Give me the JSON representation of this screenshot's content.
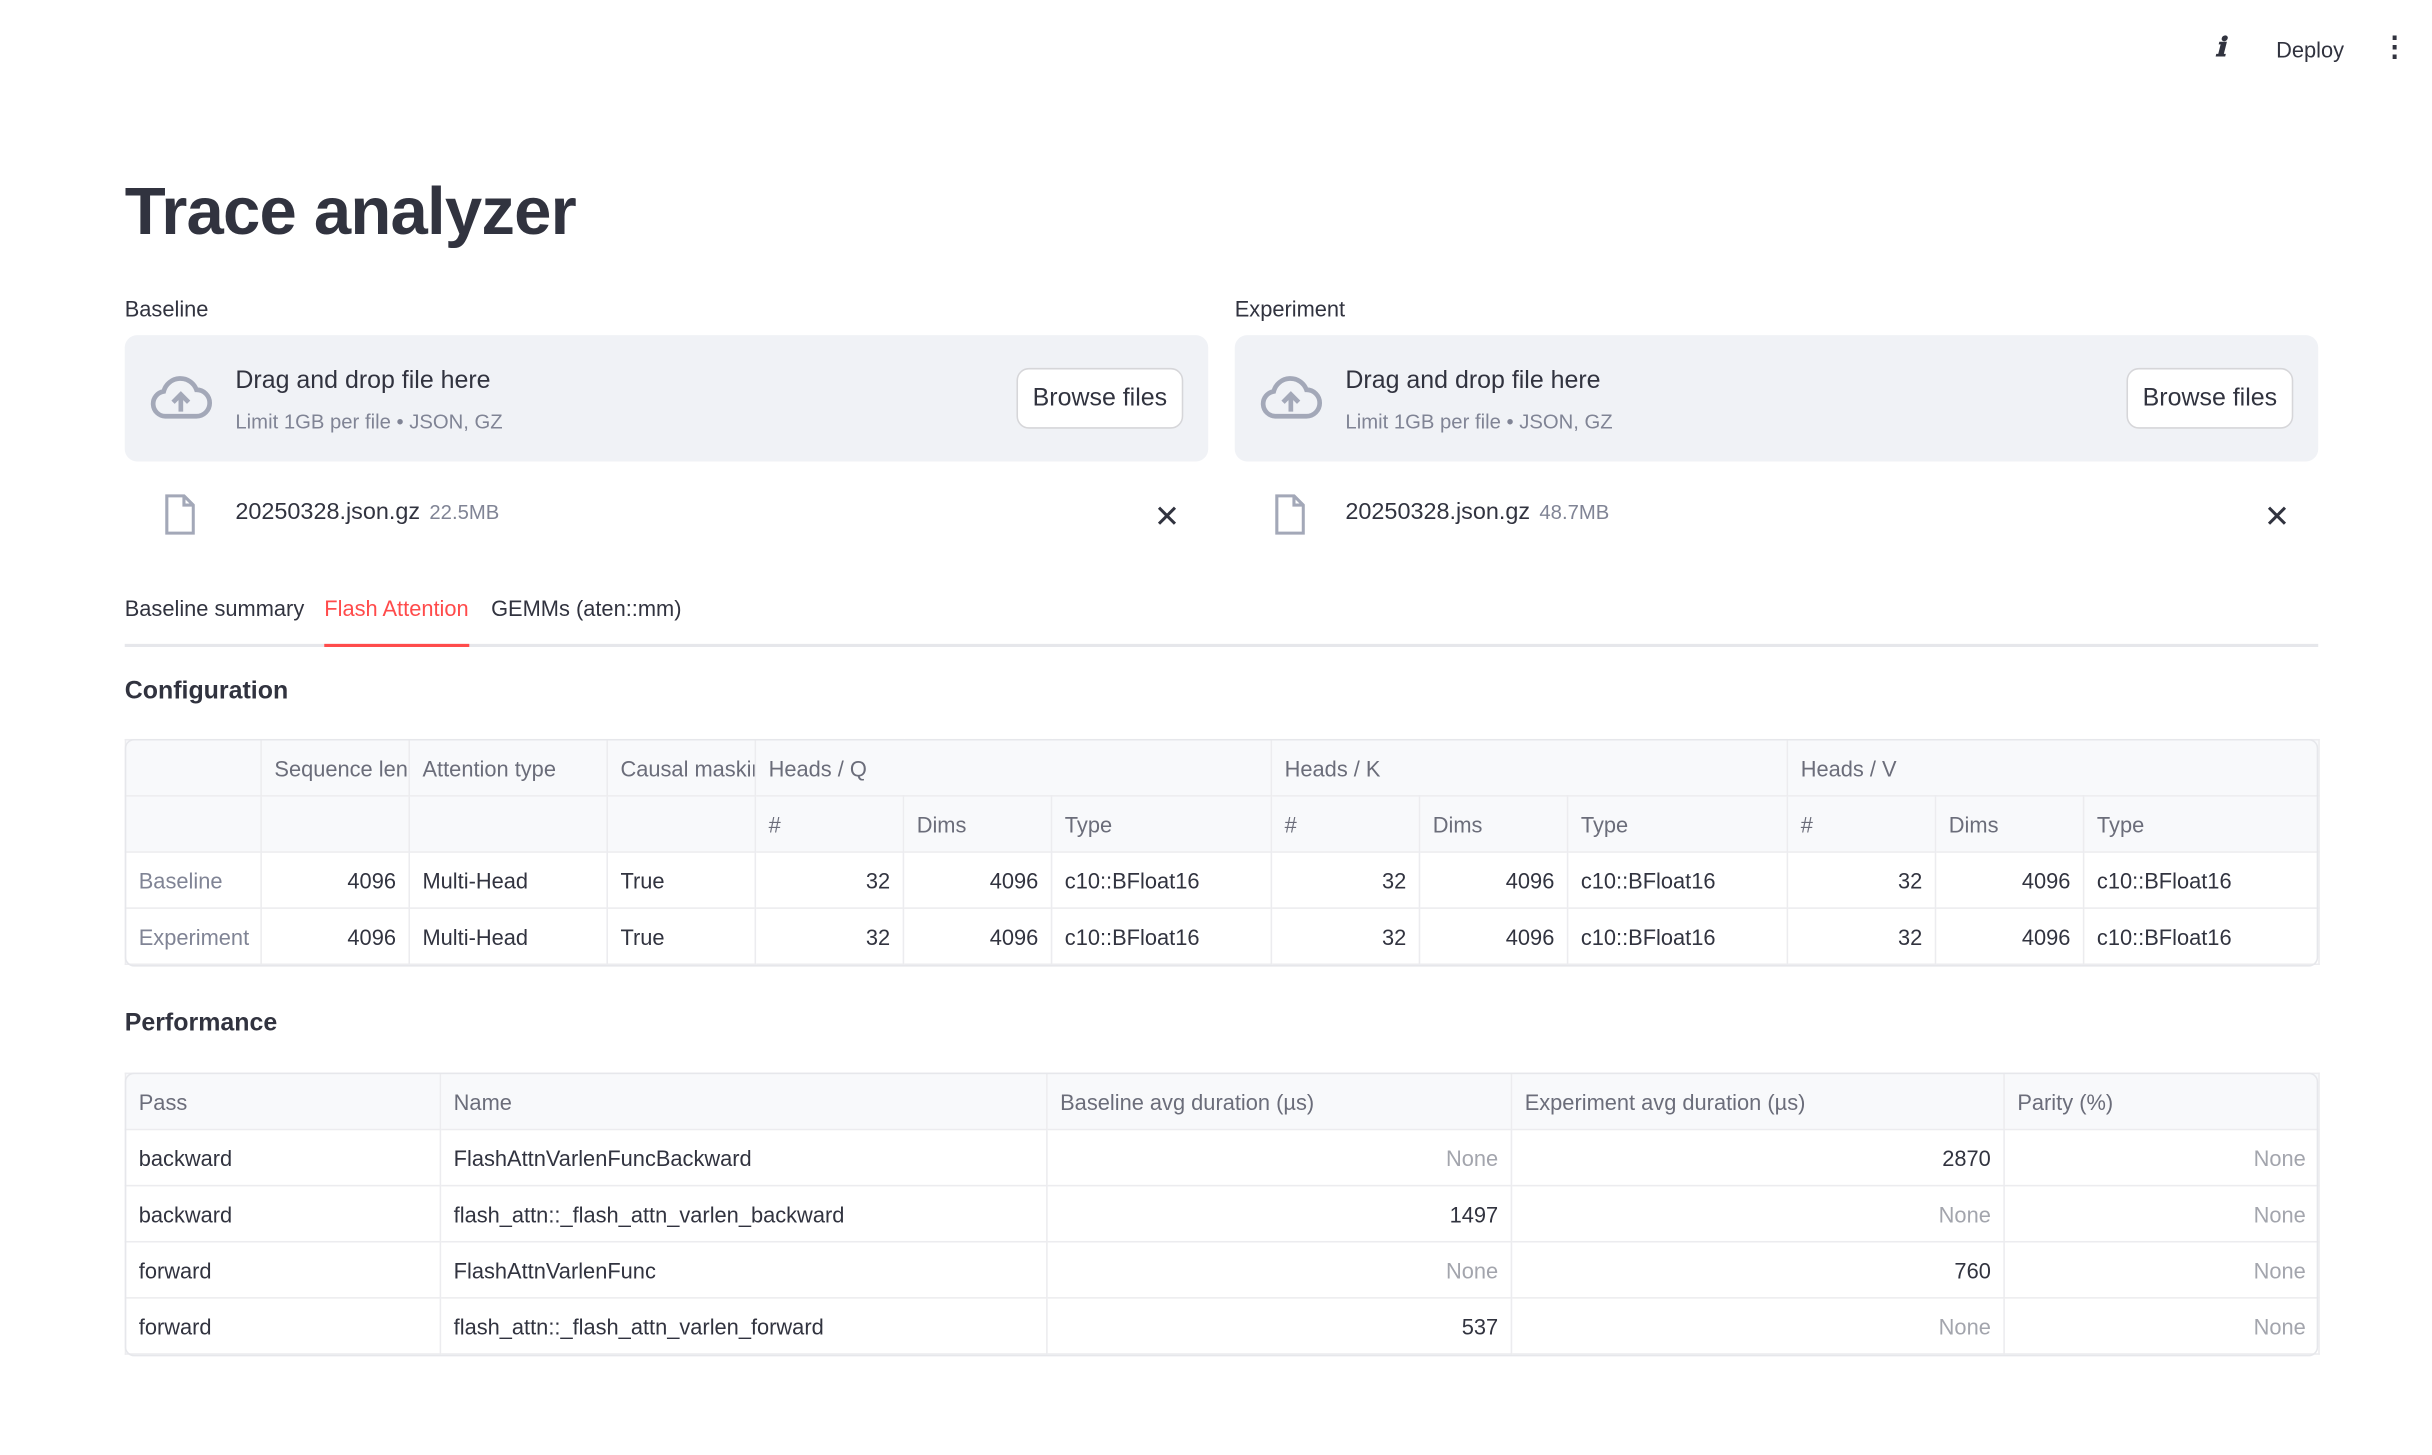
{
  "header": {
    "deploy": "Deploy",
    "info_icon": "info-icon",
    "menu_icon": "kebab-menu-icon"
  },
  "title": "Trace analyzer",
  "uploaders": [
    {
      "label": "Baseline",
      "drop_text": "Drag and drop file here",
      "limit_text": "Limit 1GB per file • JSON, GZ",
      "browse": "Browse files",
      "file": {
        "name": "20250328.json.gz",
        "size": "22.5MB"
      }
    },
    {
      "label": "Experiment",
      "drop_text": "Drag and drop file here",
      "limit_text": "Limit 1GB per file • JSON, GZ",
      "browse": "Browse files",
      "file": {
        "name": "20250328.json.gz",
        "size": "48.7MB"
      }
    }
  ],
  "tabs": [
    {
      "label": "Baseline summary"
    },
    {
      "label": "Flash Attention",
      "active": true
    },
    {
      "label": "GEMMs (aten::mm)"
    }
  ],
  "accent": "#ff4b4b",
  "configuration": {
    "title": "Configuration",
    "group_headers": [
      "",
      "Sequence leng",
      "Attention type",
      "Causal maskin",
      "Heads / Q",
      "Heads / K",
      "Heads / V"
    ],
    "sub_headers": [
      "#",
      "Dims",
      "Type",
      "#",
      "Dims",
      "Type",
      "#",
      "Dims",
      "Type"
    ],
    "rows": [
      {
        "label": "Baseline",
        "cells": [
          "4096",
          "Multi-Head",
          "True",
          "32",
          "4096",
          "c10::BFloat16",
          "32",
          "4096",
          "c10::BFloat16",
          "32",
          "4096",
          "c10::BFloat16"
        ]
      },
      {
        "label": "Experiment",
        "cells": [
          "4096",
          "Multi-Head",
          "True",
          "32",
          "4096",
          "c10::BFloat16",
          "32",
          "4096",
          "c10::BFloat16",
          "32",
          "4096",
          "c10::BFloat16"
        ]
      }
    ]
  },
  "performance": {
    "title": "Performance",
    "headers": [
      "Pass",
      "Name",
      "Baseline avg duration (µs)",
      "Experiment avg duration (µs)",
      "Parity (%)"
    ],
    "rows": [
      [
        "backward",
        "FlashAttnVarlenFuncBackward",
        "None",
        "2870",
        "None"
      ],
      [
        "backward",
        "flash_attn::_flash_attn_varlen_backward",
        "1497",
        "None",
        "None"
      ],
      [
        "forward",
        "FlashAttnVarlenFunc",
        "None",
        "760",
        "None"
      ],
      [
        "forward",
        "flash_attn::_flash_attn_varlen_forward",
        "537",
        "None",
        "None"
      ]
    ]
  }
}
